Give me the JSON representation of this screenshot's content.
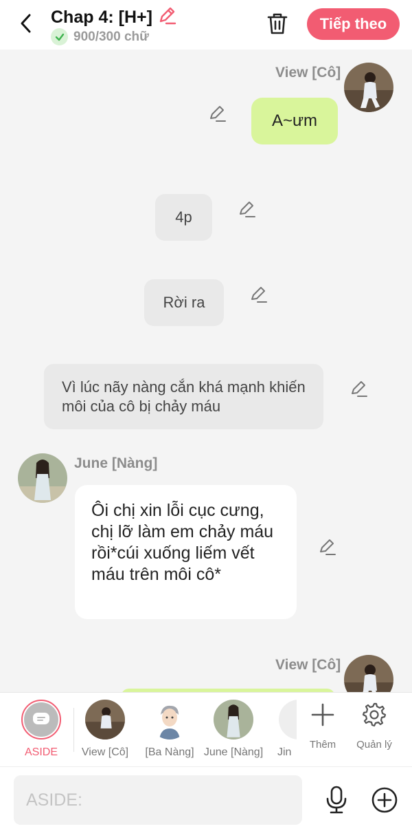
{
  "header": {
    "title": "Chap 4: [H+]",
    "word_count": "900/300 chữ",
    "next_label": "Tiếp theo",
    "accent": "#f25c72"
  },
  "messages": [
    {
      "speaker": "View [Cô]",
      "text": "A~ưm",
      "style": "right-green"
    },
    {
      "text": "4p",
      "style": "narration"
    },
    {
      "text": "Rời ra",
      "style": "narration"
    },
    {
      "text": "Vì lúc nãy nàng cắn khá mạnh khiến môi của cô bị chảy máu",
      "style": "narration"
    },
    {
      "speaker": "June [Nàng]",
      "text": "Ôi chị xin lỗi cục cưng, chị lỡ làm em chảy máu rồi*cúi xuống liếm vết máu trên môi cô*",
      "style": "left-white"
    },
    {
      "speaker": "View [Cô]",
      "text": "",
      "style": "right-green"
    }
  ],
  "characters": [
    {
      "label": "ASIDE"
    },
    {
      "label": "View [Cô]"
    },
    {
      "label": "[Ba Nàng]"
    },
    {
      "label": "June [Nàng]"
    },
    {
      "label": "Jin"
    }
  ],
  "tools": {
    "add_label": "Thêm",
    "manage_label": "Quản lý"
  },
  "composer": {
    "placeholder": "ASIDE:"
  }
}
